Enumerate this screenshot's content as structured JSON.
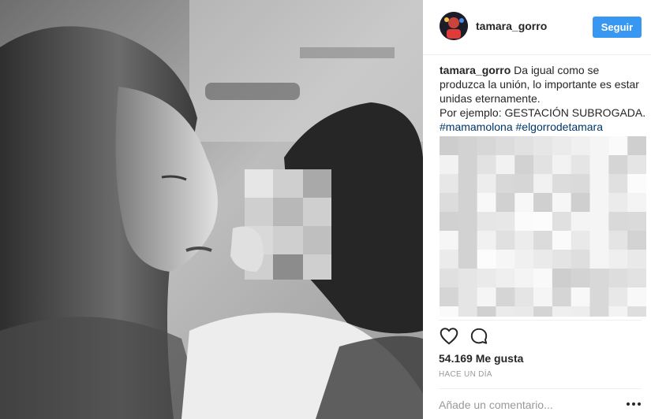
{
  "post": {
    "image_alt": "Foto en blanco y negro",
    "author": {
      "username": "tamara_gorro",
      "avatar_icon": "profile-avatar"
    },
    "follow_label": "Seguir",
    "caption": {
      "username": "tamara_gorro",
      "line1": "Da igual como se produzca la unión, lo importante es estar unidas eternamente.",
      "line2": "Por ejemplo: GESTACIÓN SUBROGADA.",
      "hashtags": [
        "#mamamolona",
        "#elgorrodetamara"
      ]
    },
    "actions": {
      "like_icon": "heart-icon",
      "comment_icon": "comment-bubble-icon"
    },
    "likes_text": "54.169 Me gusta",
    "timestamp": "HACE UN DÍA",
    "comment_placeholder": "Añade un comentario...",
    "more_icon": "ellipsis-icon"
  },
  "colors": {
    "accent": "#3897f0",
    "hashtag": "#003569",
    "meta": "#999999",
    "divider": "#efefef"
  }
}
